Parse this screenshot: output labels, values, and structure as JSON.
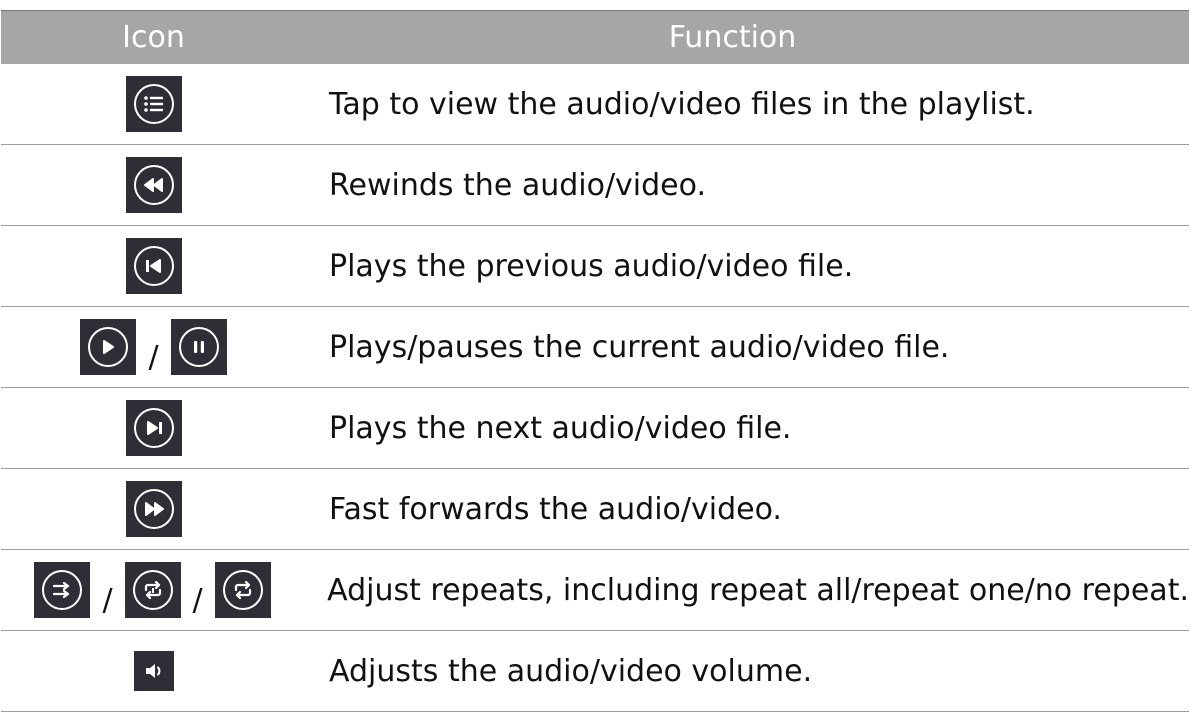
{
  "table": {
    "headers": {
      "icon": "Icon",
      "function": "Function"
    },
    "separator": "/",
    "rows": [
      {
        "icons": [
          "playlist-icon"
        ],
        "function": "Tap to view the audio/video files in the playlist."
      },
      {
        "icons": [
          "rewind-icon"
        ],
        "function": "Rewinds the audio/video."
      },
      {
        "icons": [
          "previous-track-icon"
        ],
        "function": "Plays the previous audio/video file."
      },
      {
        "icons": [
          "play-icon",
          "pause-icon"
        ],
        "function": "Plays/pauses the current audio/video file."
      },
      {
        "icons": [
          "next-track-icon"
        ],
        "function": "Plays the next audio/video file."
      },
      {
        "icons": [
          "fast-forward-icon"
        ],
        "function": "Fast forwards the audio/video."
      },
      {
        "icons": [
          "repeat-all-icon",
          "repeat-one-icon",
          "no-repeat-icon"
        ],
        "function": "Adjust repeats, including repeat all/repeat one/no repeat."
      },
      {
        "icons": [
          "volume-icon"
        ],
        "function": "Adjusts the audio/video volume."
      }
    ]
  },
  "colors": {
    "header_bg": "#a6a6a6",
    "icon_bg": "#2f2e36",
    "row_border": "#9e9e9e"
  }
}
